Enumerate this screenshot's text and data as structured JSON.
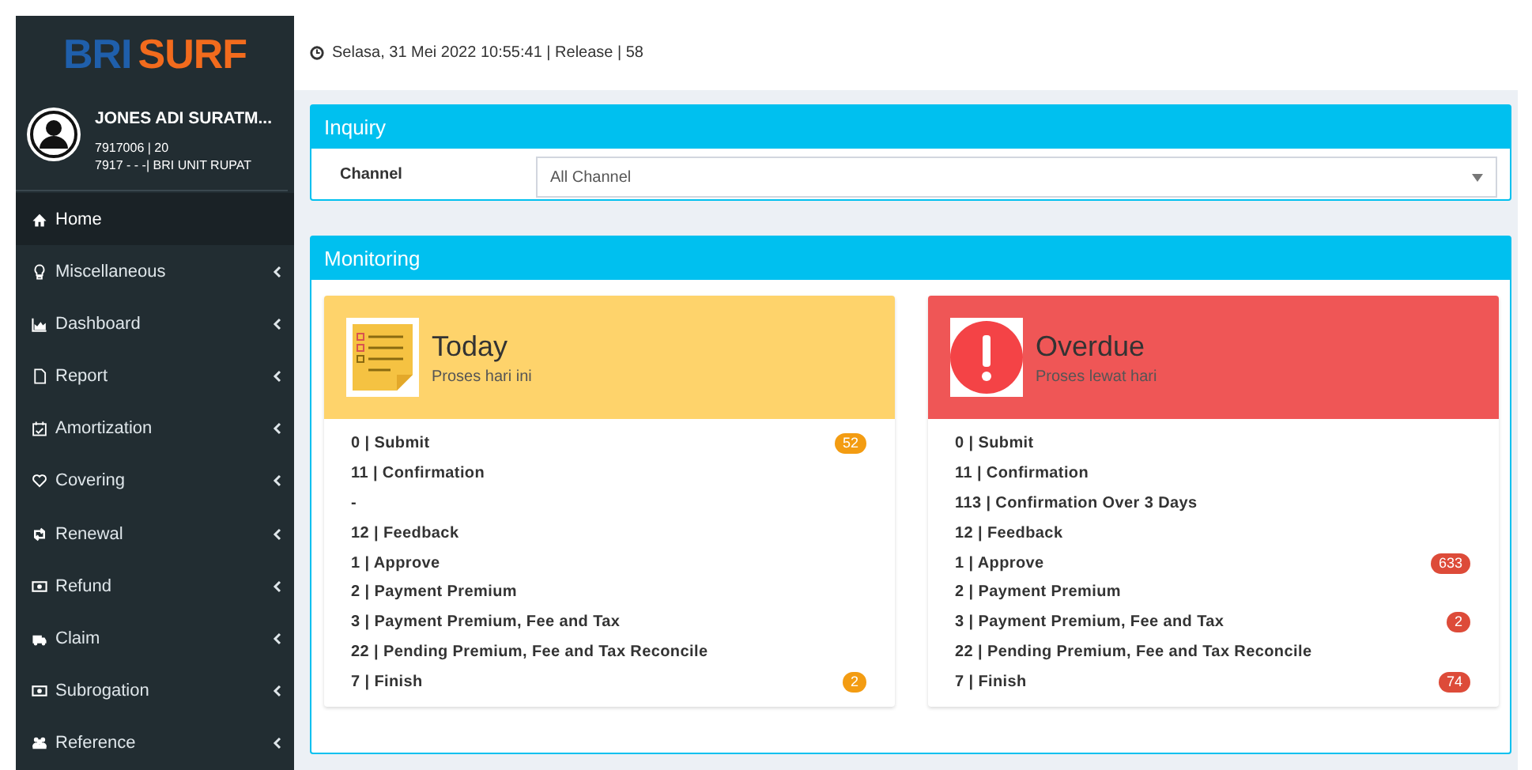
{
  "logo": {
    "left": "BRI",
    "right": "SURF"
  },
  "user": {
    "name": "JONES ADI SURATM...",
    "line_1": "7917006 | 20",
    "line_2": "7917 - - -| BRI UNIT RUPAT"
  },
  "menu": [
    {
      "label": "Home",
      "selected": true,
      "expandable": false
    },
    {
      "label": "Miscellaneous",
      "selected": false,
      "expandable": true
    },
    {
      "label": "Dashboard",
      "selected": false,
      "expandable": true
    },
    {
      "label": "Report",
      "selected": false,
      "expandable": true
    },
    {
      "label": "Amortization",
      "selected": false,
      "expandable": true
    },
    {
      "label": "Covering",
      "selected": false,
      "expandable": true
    },
    {
      "label": "Renewal",
      "selected": false,
      "expandable": true
    },
    {
      "label": "Refund",
      "selected": false,
      "expandable": true
    },
    {
      "label": "Claim",
      "selected": false,
      "expandable": true
    },
    {
      "label": "Subrogation",
      "selected": false,
      "expandable": true
    },
    {
      "label": "Reference",
      "selected": false,
      "expandable": true
    }
  ],
  "top_bar": {
    "text": "Selasa, 31 Mei 2022 10:55:41 | Release | 58"
  },
  "inquiry": {
    "title": "Inquiry",
    "channel_label": "Channel",
    "channel_value": "All Channel"
  },
  "monitoring": {
    "title": "Monitoring",
    "cards": [
      {
        "kind": "notes",
        "color": "#fed36b",
        "title": "Today",
        "subtitle": "Proses hari ini",
        "rows": [
          {
            "text": "0 | Submit",
            "badge": "52"
          },
          {
            "text": "11 | Confirmation"
          },
          {
            "text": "-"
          },
          {
            "text": "12 | Feedback"
          },
          {
            "text": "1 | Approve"
          },
          {
            "text": "2 | Payment Premium"
          },
          {
            "text": "3 | Payment Premium, Fee and Tax"
          },
          {
            "text": "22 | Pending Premium, Fee and Tax Reconcile"
          },
          {
            "text": "7 | Finish",
            "badge": "2"
          }
        ]
      },
      {
        "kind": "alert",
        "color": "#ef5656",
        "title": "Overdue",
        "subtitle": "Proses lewat hari",
        "rows": [
          {
            "text": "0 | Submit"
          },
          {
            "text": "11 | Confirmation"
          },
          {
            "text": "113 | Confirmation Over 3 Days"
          },
          {
            "text": "12 | Feedback"
          },
          {
            "text": "1 | Approve",
            "badge": "633"
          },
          {
            "text": "2 | Payment Premium"
          },
          {
            "text": "3 | Payment Premium, Fee and Tax",
            "badge": "2"
          },
          {
            "text": "22 | Pending Premium, Fee and Tax Reconcile"
          },
          {
            "text": "7 | Finish",
            "badge": "74"
          }
        ]
      }
    ]
  }
}
